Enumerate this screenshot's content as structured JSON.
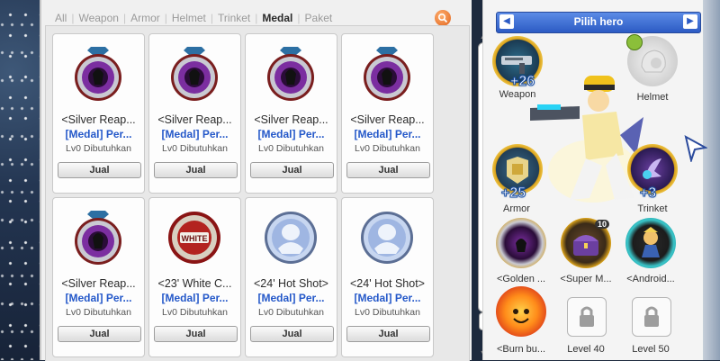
{
  "filters": {
    "tabs": [
      "All",
      "Weapon",
      "Armor",
      "Helmet",
      "Trinket",
      "Medal",
      "Paket"
    ],
    "active": "Medal"
  },
  "items": [
    {
      "name": "<Silver Reap...",
      "type": "[Medal] Per...",
      "req": "Lv0 Dibutuhkan",
      "sell": "Jual",
      "icon": "silver-reaper-medal-icon"
    },
    {
      "name": "<Silver Reap...",
      "type": "[Medal] Per...",
      "req": "Lv0 Dibutuhkan",
      "sell": "Jual",
      "icon": "silver-reaper-medal-icon"
    },
    {
      "name": "<Silver Reap...",
      "type": "[Medal] Per...",
      "req": "Lv0 Dibutuhkan",
      "sell": "Jual",
      "icon": "silver-reaper-medal-icon"
    },
    {
      "name": "<Silver Reap...",
      "type": "[Medal] Per...",
      "req": "Lv0 Dibutuhkan",
      "sell": "Jual",
      "icon": "silver-reaper-medal-icon"
    },
    {
      "name": "<Silver Reap...",
      "type": "[Medal] Per...",
      "req": "Lv0 Dibutuhkan",
      "sell": "Jual",
      "icon": "silver-reaper-medal-icon"
    },
    {
      "name": "<23' White C...",
      "type": "[Medal] Per...",
      "req": "Lv0 Dibutuhkan",
      "sell": "Jual",
      "icon": "white-medal-icon"
    },
    {
      "name": "<24' Hot Shot>",
      "type": "[Medal] Per...",
      "req": "Lv0 Dibutuhkan",
      "sell": "Jual",
      "icon": "hot-shot-medal-icon"
    },
    {
      "name": "<24' Hot Shot>",
      "type": "[Medal] Per...",
      "req": "Lv0 Dibutuhkan",
      "sell": "Jual",
      "icon": "hot-shot-medal-icon"
    }
  ],
  "hero": {
    "title": "Pilih hero",
    "slots": {
      "weapon": {
        "label": "Weapon",
        "bonus": "+26",
        "icon": "gun-icon"
      },
      "helmet": {
        "label": "Helmet",
        "icon": "helmet-icon"
      },
      "armor": {
        "label": "Armor",
        "bonus": "+25",
        "icon": "armor-icon"
      },
      "trinket": {
        "label": "Trinket",
        "bonus": "+3",
        "icon": "trinket-icon"
      },
      "golden": {
        "label": "<Golden ...",
        "icon": "golden-medal-icon"
      },
      "super": {
        "label": "<Super M...",
        "icon": "chest-icon",
        "badge": "10"
      },
      "android": {
        "label": "<Android...",
        "icon": "android-icon"
      },
      "burn": {
        "label": "<Burn bu...",
        "icon": "fire-icon"
      },
      "lock40": {
        "label": "Level 40",
        "icon": "lock-icon"
      },
      "lock50": {
        "label": "Level 50",
        "icon": "lock-icon"
      }
    }
  }
}
